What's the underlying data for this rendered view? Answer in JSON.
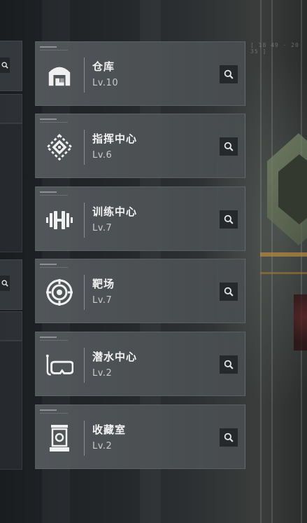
{
  "background": {
    "readout": "[ 18 49 · 20 35 ]"
  },
  "facilities": [
    {
      "name": "仓库",
      "level": "Lv.10",
      "icon": "warehouse-icon"
    },
    {
      "name": "指挥中心",
      "level": "Lv.6",
      "icon": "chip-icon"
    },
    {
      "name": "训练中心",
      "level": "Lv.7",
      "icon": "dumbbell-icon"
    },
    {
      "name": "靶场",
      "level": "Lv.7",
      "icon": "target-icon"
    },
    {
      "name": "潜水中心",
      "level": "Lv.2",
      "icon": "diving-mask-icon"
    },
    {
      "name": "收藏室",
      "level": "Lv.2",
      "icon": "display-case-icon"
    }
  ],
  "colors": {
    "card_bg": "#565a5d",
    "text": "#f2f2f2",
    "level_text": "#c9cacb",
    "search_bg": "#24272a"
  }
}
